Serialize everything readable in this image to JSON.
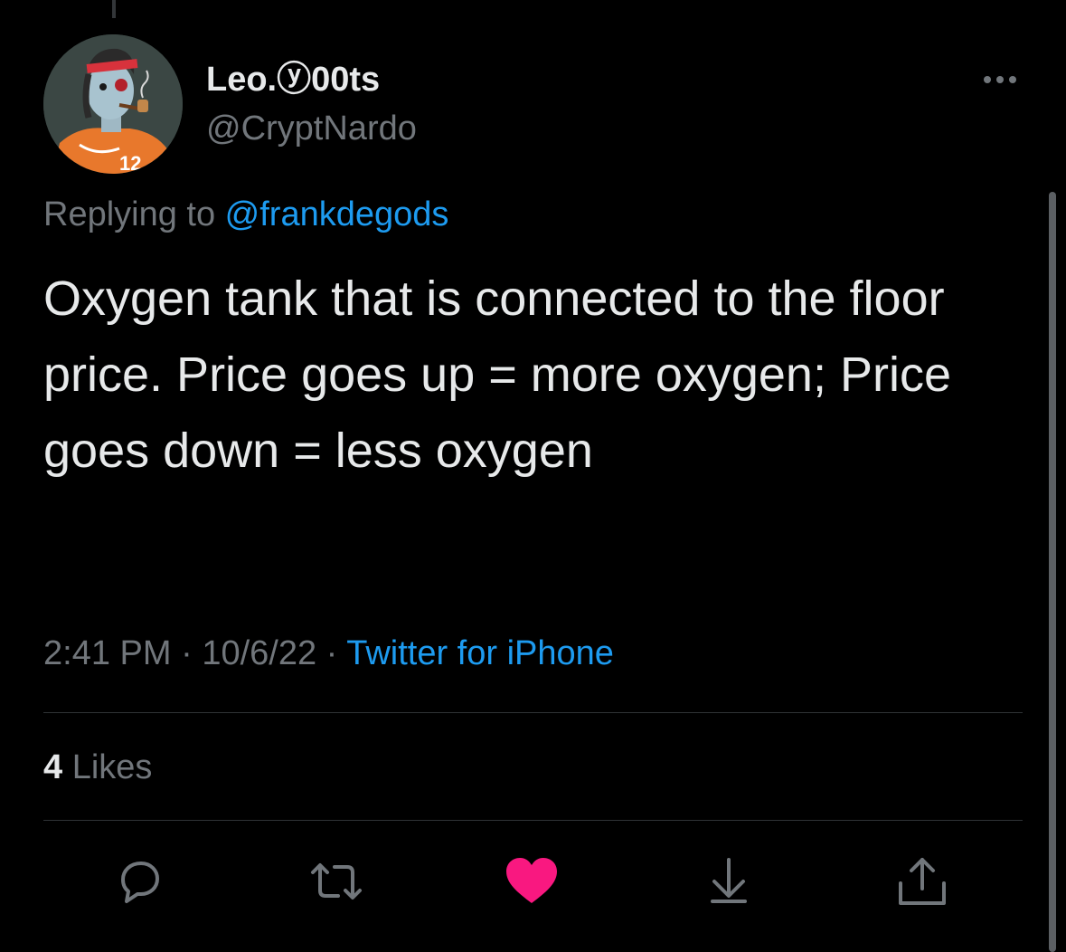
{
  "author": {
    "display_name": "Leo.ⓨ00ts",
    "handle": "@CryptNardo"
  },
  "reply_context": {
    "prefix": "Replying to ",
    "mention": "@frankdegods"
  },
  "tweet": {
    "text": "Oxygen tank that is connected to the floor price. Price goes up = more oxygen; Price goes down = less oxygen"
  },
  "meta": {
    "time": "2:41 PM",
    "separator": " · ",
    "date": "10/6/22",
    "source": "Twitter for iPhone"
  },
  "engagement": {
    "likes_count": "4",
    "likes_label": " Likes"
  },
  "actions": {
    "reply": "reply-icon",
    "retweet": "retweet-icon",
    "like": "heart-icon",
    "bookmark": "bookmark-download-icon",
    "share": "share-icon",
    "liked": true
  },
  "colors": {
    "background": "#000000",
    "text_primary": "#e7e9ea",
    "text_secondary": "#71767b",
    "accent_blue": "#1d9bf0",
    "like_pink": "#f91880",
    "divider": "#2f3336"
  }
}
